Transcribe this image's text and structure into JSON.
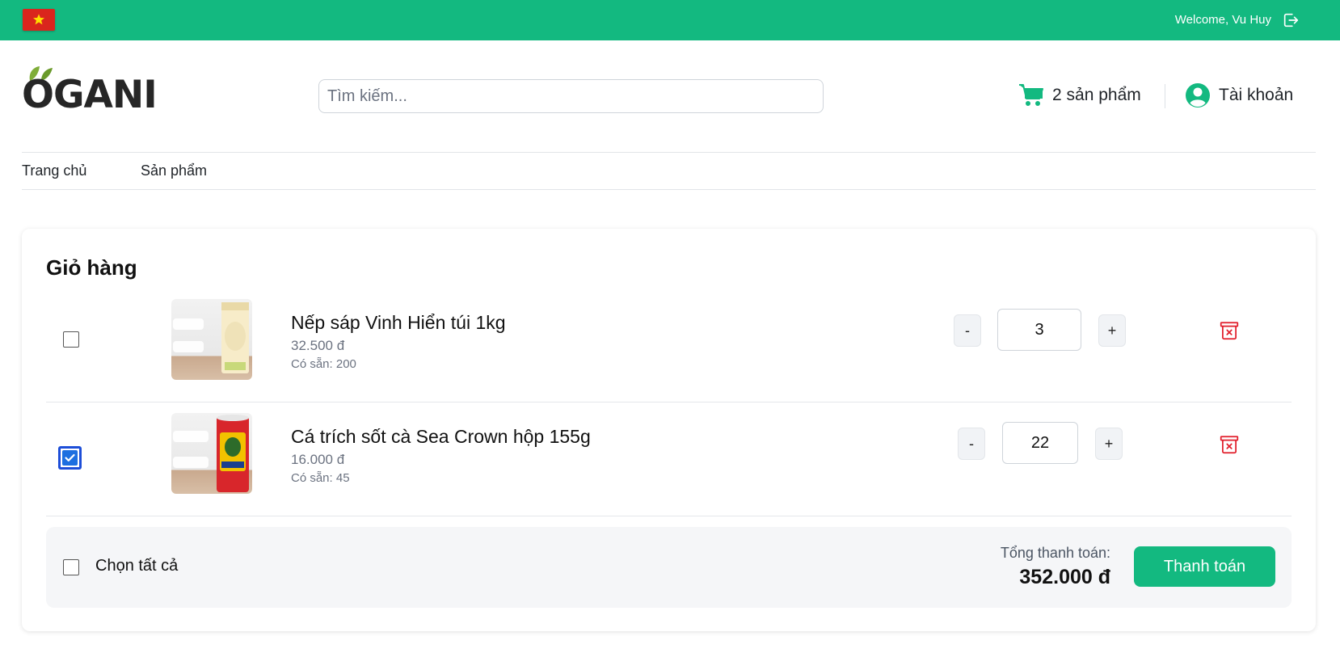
{
  "topbar": {
    "flag": "vietnam-flag",
    "welcome": "Welcome, Vu Huy"
  },
  "header": {
    "logo": "OGANI",
    "search_placeholder": "Tìm kiếm...",
    "cart_label": "2 sản phẩm",
    "account_label": "Tài khoản"
  },
  "nav": {
    "items": [
      {
        "label": "Trang chủ"
      },
      {
        "label": "Sản phẩm"
      }
    ]
  },
  "cart": {
    "title": "Giỏ hàng",
    "items": [
      {
        "name": "Nếp sáp Vinh Hiển túi 1kg",
        "price": "32.500 đ",
        "stock": "Có sẵn: 200",
        "quantity": "3",
        "checked": false,
        "minus": "-",
        "plus": "+"
      },
      {
        "name": "Cá trích sốt cà Sea Crown hộp 155g",
        "price": "16.000 đ",
        "stock": "Có sẵn: 45",
        "quantity": "22",
        "checked": true,
        "minus": "-",
        "plus": "+"
      }
    ],
    "select_all": "Chọn tất cả",
    "total_label": "Tổng thanh toán:",
    "total_value": "352.000 đ",
    "checkout": "Thanh toán"
  },
  "colors": {
    "brand": "#13b980",
    "delete": "#e11d2a",
    "checkbox_checked": "#1d6fe0"
  }
}
